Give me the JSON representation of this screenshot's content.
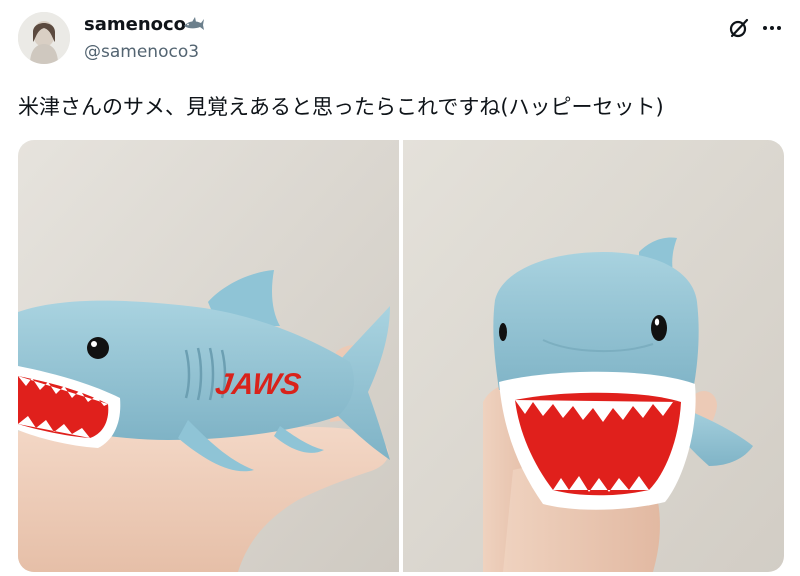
{
  "post": {
    "author_name": "samenoco",
    "author_handle": "@samenoco3",
    "text": "米津さんのサメ、見覚えあると思ったらこれですね(ハッピーセット)"
  },
  "icons": {
    "name_badge": "shark-icon",
    "grok": "grok-icon",
    "more": "more-dots-icon"
  },
  "media": {
    "photo_left_logo": "JAWS",
    "photo_count": 2
  },
  "colors": {
    "text_primary": "#0f1419",
    "text_secondary": "#536471",
    "shark_body": "#8fc4d6",
    "shark_mouth": "#e0201c",
    "jaws_logo": "#d9221b",
    "wall": "#ddd9d2"
  }
}
